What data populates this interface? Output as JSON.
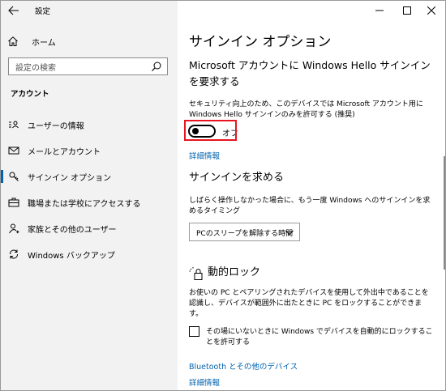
{
  "window": {
    "title": "設定",
    "controls": [
      "minimize",
      "maximize",
      "close"
    ]
  },
  "sidebar": {
    "home_label": "ホーム",
    "search_placeholder": "設定の検索",
    "section_header": "アカウント",
    "items": [
      {
        "label": "ユーザーの情報",
        "icon": "user-card-icon",
        "selected": false
      },
      {
        "label": "メールとアカウント",
        "icon": "mail-icon",
        "selected": false
      },
      {
        "label": "サインイン オプション",
        "icon": "key-icon",
        "selected": true
      },
      {
        "label": "職場または学校にアクセスする",
        "icon": "briefcase-icon",
        "selected": false
      },
      {
        "label": "家族とその他のユーザー",
        "icon": "person-add-icon",
        "selected": false
      },
      {
        "label": "Windows バックアップ",
        "icon": "sync-icon",
        "selected": false
      }
    ]
  },
  "main": {
    "page_title": "サインイン オプション",
    "hello_section": {
      "heading": "Microsoft アカウントに Windows Hello サインインを要求する",
      "description": "セキュリティ向上のため、このデバイスでは Microsoft アカウント用に Windows Hello サインインのみを許可する (推奨)",
      "toggle_state": "オフ",
      "toggle_on": false,
      "details_link": "詳細情報"
    },
    "require_signin": {
      "heading": "サインインを求める",
      "description": "しばらく操作しなかった場合に、もう一度 Windows へのサインインを求めるタイミング",
      "dropdown_value": "PCのスリープを解除する時間"
    },
    "dynamic_lock": {
      "heading": "動的ロック",
      "description": "お使いの PC とペアリングされたデバイスを使用して外出中であることを認識し、デバイスが範囲外に出たときに PC をロックすることができます。",
      "checkbox_label": "その場にいないときに Windows でデバイスを自動的にロックすることを許可する",
      "checkbox_checked": false,
      "bluetooth_link": "Bluetooth とその他のデバイス",
      "details_link": "詳細情報"
    }
  },
  "colors": {
    "accent": "#0063b1",
    "highlight_box": "#e8141f",
    "sidebar_bg": "#f2f2f2"
  }
}
